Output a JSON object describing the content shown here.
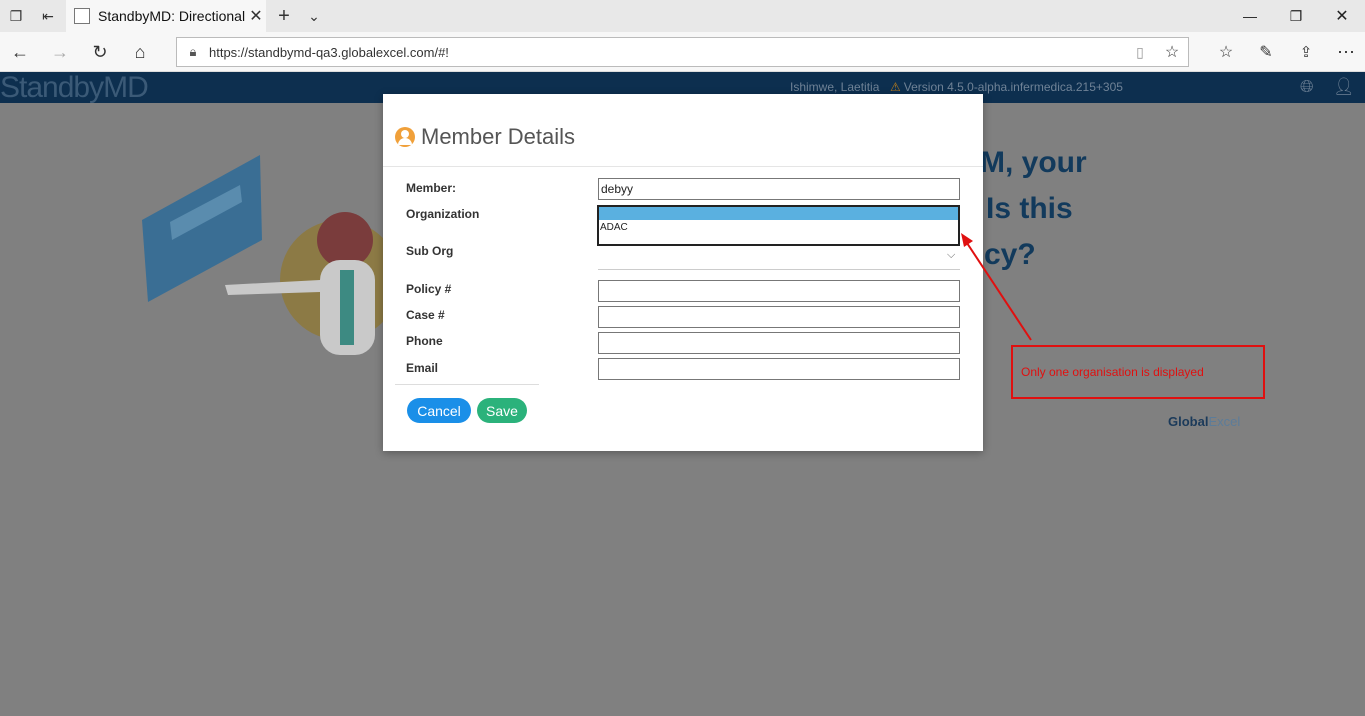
{
  "browser": {
    "tab_title": "StandbyMD: Directional",
    "url": "https://standbymd-qa3.globalexcel.com/#!"
  },
  "app": {
    "logo": "StandbyMD",
    "user_name": "Ishimwe, Laetitia",
    "version": "Version 4.5.0-alpha.infermedica.215+305",
    "bg_line1": "M, your",
    "bg_line2": "Is this",
    "bg_line3": "cy?",
    "footer_logo_bold": "Global",
    "footer_logo_light": "Excel"
  },
  "modal": {
    "title": "Member Details",
    "labels": {
      "member": "Member:",
      "organization": "Organization",
      "sub_org": "Sub Org",
      "policy": "Policy #",
      "case": "Case #",
      "phone": "Phone",
      "email": "Email"
    },
    "member_value": "debyy",
    "org_options": [
      "",
      "ADAC"
    ],
    "cancel_label": "Cancel",
    "save_label": "Save"
  },
  "annotation": {
    "text": "Only one organisation is displayed",
    "color": "#e01010"
  }
}
